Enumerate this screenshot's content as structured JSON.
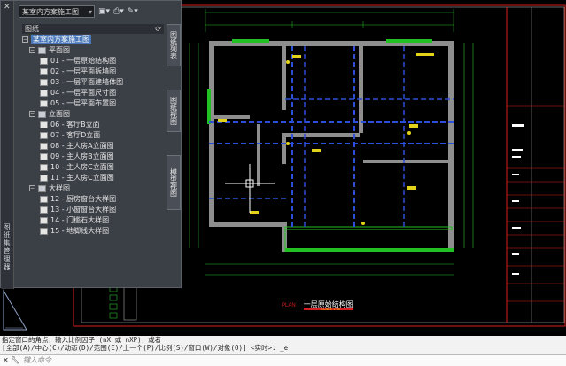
{
  "palette": {
    "combo_value": "某室内方案施工图",
    "vertical_title": "图纸集管理器",
    "sheets_header": "图纸",
    "refresh_icon": "refresh-icon",
    "root_sheetset": "某室内方案施工图",
    "tree": [
      {
        "type": "group",
        "label": "平面图",
        "expanded": true
      },
      {
        "type": "sheet",
        "label": "01 - 一层原始结构图"
      },
      {
        "type": "sheet",
        "label": "02 - 一层平面拆墙图"
      },
      {
        "type": "sheet",
        "label": "03 - 一层平面建墙体图"
      },
      {
        "type": "sheet",
        "label": "04 - 一层平面尺寸图"
      },
      {
        "type": "sheet",
        "label": "05 - 一层平面布置图"
      },
      {
        "type": "group",
        "label": "立面图",
        "expanded": true
      },
      {
        "type": "sheet",
        "label": "06 - 客厅B立面"
      },
      {
        "type": "sheet",
        "label": "07 - 客厅D立面"
      },
      {
        "type": "sheet",
        "label": "08 - 主人房A立面图"
      },
      {
        "type": "sheet",
        "label": "09 - 主人房B立面图"
      },
      {
        "type": "sheet",
        "label": "10 - 主人房C立面图"
      },
      {
        "type": "sheet",
        "label": "11 - 主人房C立面图"
      },
      {
        "type": "group",
        "label": "大样图",
        "expanded": true
      },
      {
        "type": "sheet",
        "label": "12 - 厨房窗台大样图"
      },
      {
        "type": "sheet",
        "label": "13 - 小窗窗台大样图"
      },
      {
        "type": "sheet",
        "label": "14 - 门槛石大样图"
      },
      {
        "type": "sheet",
        "label": "15 - 地脚线大样图"
      }
    ],
    "tabs": [
      "图纸列表",
      "图纸视图",
      "模型视图"
    ]
  },
  "drawing": {
    "plan_title": "一层原始结构图",
    "plan_prefix": "PLAN",
    "scale": "SCALE 1:50"
  },
  "command": {
    "history_1": "指定窗口的角点，输入比例因子 (nX 或 nXP)，或者",
    "history_2": "[全部(A)/中心(C)/动态(D)/范围(E)/上一个(P)/比例(S)/窗口(W)/对象(O)] <实时>: _e",
    "placeholder": "键入命令"
  }
}
